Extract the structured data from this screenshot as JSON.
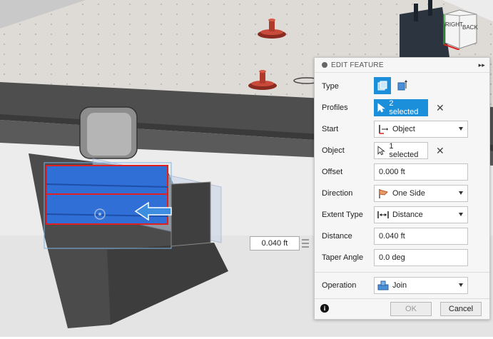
{
  "viewport": {
    "dimension_value": "0.040 ft",
    "viewcube": {
      "right": "RIGHT",
      "back": "BACK"
    }
  },
  "panel": {
    "title": "EDIT FEATURE",
    "rows": {
      "type": {
        "label": "Type"
      },
      "profiles": {
        "label": "Profiles",
        "value": "2 selected"
      },
      "start": {
        "label": "Start",
        "value": "Object"
      },
      "object": {
        "label": "Object",
        "value": "1 selected"
      },
      "offset": {
        "label": "Offset",
        "value": "0.000 ft"
      },
      "direction": {
        "label": "Direction",
        "value": "One Side"
      },
      "extent_type": {
        "label": "Extent Type",
        "value": "Distance"
      },
      "distance": {
        "label": "Distance",
        "value": "0.040 ft"
      },
      "taper_angle": {
        "label": "Taper Angle",
        "value": "0.0 deg"
      },
      "operation": {
        "label": "Operation",
        "value": "Join"
      }
    },
    "footer": {
      "ok": "OK",
      "cancel": "Cancel",
      "info_glyph": "i"
    }
  },
  "colors": {
    "accent": "#1b8fd9",
    "selection_red": "#e02020",
    "profile_blue": "#2f6fd6"
  }
}
